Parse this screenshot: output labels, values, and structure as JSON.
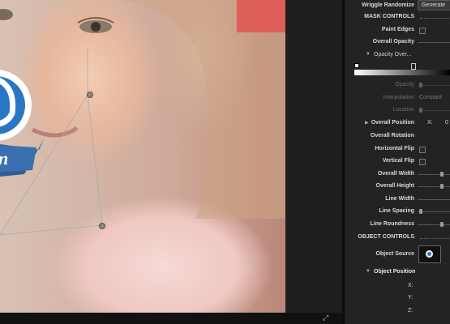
{
  "panel": {
    "wriggle_label": "Wriggle Randomize",
    "generate_label": "Generate",
    "mask_controls": "MASK CONTROLS",
    "paint_edges": "Paint Edges",
    "overall_opacity": "Overall Opacity",
    "opacity_overlay": "Opacity Over...",
    "opacity": "Opacity",
    "interpolation": "Interpolation",
    "interpolation_value": "Constant",
    "location": "Location",
    "overall_position": "Overall Position",
    "x_label": "X:",
    "x_value": "0",
    "overall_rotation": "Overall Rotation",
    "horizontal_flip": "Horizontal Flip",
    "vertical_flip": "Vertical Flip",
    "overall_width": "Overall Width",
    "overall_height": "Overall Height",
    "line_width": "Line Width",
    "line_spacing": "Line Spacing",
    "line_roundness": "Line Roundness",
    "object_controls": "OBJECT CONTROLS",
    "object_source": "Object Source",
    "object_position": "Object Position",
    "x": "X:",
    "y": "Y:",
    "z": "Z:"
  },
  "colors": {
    "accent_blue": "#2b76c4",
    "ribbon": "#2e5c98",
    "panel_bg": "#232323"
  }
}
